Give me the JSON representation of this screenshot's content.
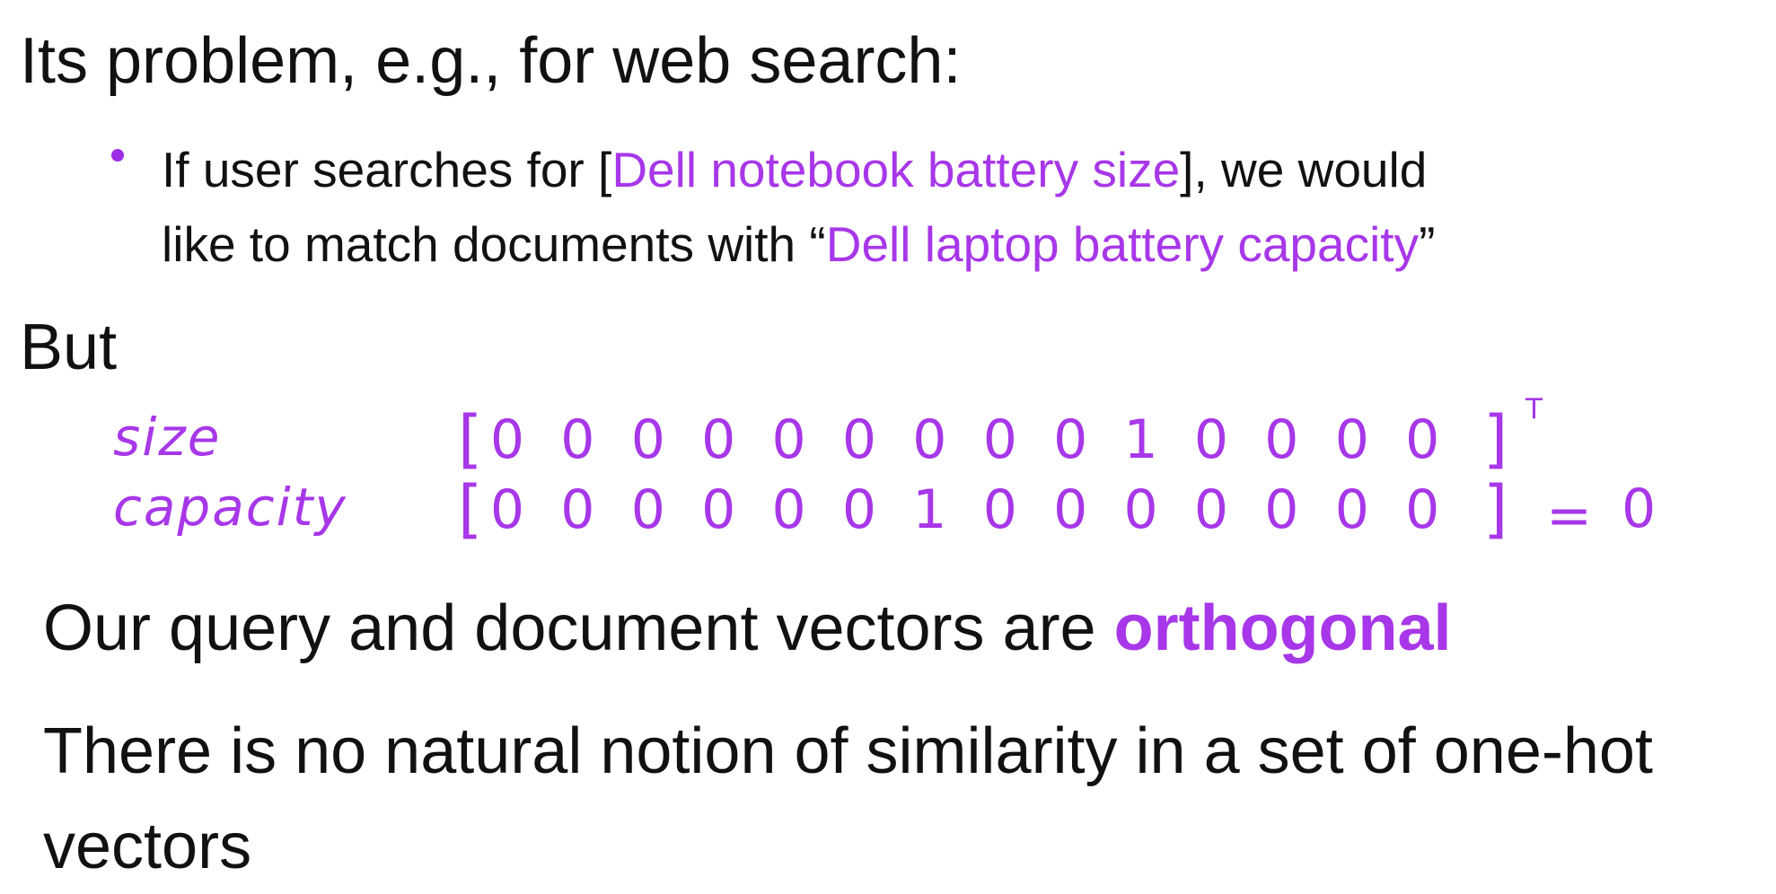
{
  "slide": {
    "heading_problem": "Its problem, e.g., for web search:",
    "bullet": {
      "prefix": "If user searches for [",
      "query": "Dell notebook battery size",
      "middle": "], we would",
      "line_two_prefix": "like to match documents with “",
      "document": "Dell laptop battery capacity",
      "suffix": "”"
    },
    "heading_but": "But",
    "vectors": {
      "size": {
        "label": "size",
        "values": [
          "0",
          "0",
          "0",
          "0",
          "0",
          "0",
          "0",
          "0",
          "0",
          "1",
          "0",
          "0",
          "0",
          "0"
        ],
        "transpose": "T"
      },
      "capacity": {
        "label": "capacity",
        "values": [
          "0",
          "0",
          "0",
          "0",
          "0",
          "0",
          "1",
          "0",
          "0",
          "0",
          "0",
          "0",
          "0",
          "0"
        ],
        "equals": "=",
        "result": "0"
      }
    },
    "orthogonal_statement": {
      "prefix": "Our query and document vectors are ",
      "highlight": "orthogonal"
    },
    "similarity_statement": "There is no natural notion of similarity in a set of one-hot vectors",
    "colors": {
      "accent": "#a737e8",
      "bullet": "#9b2ee6",
      "text": "#111111",
      "background": "#ffffff"
    }
  }
}
